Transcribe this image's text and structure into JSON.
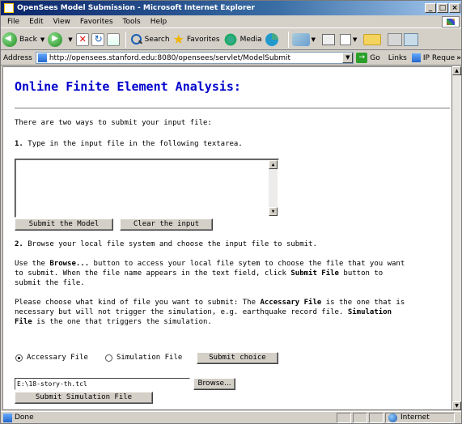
{
  "window": {
    "title": "OpenSees Model Submission - Microsoft Internet Explorer",
    "controls": [
      "_",
      "□",
      "×"
    ]
  },
  "menubar": {
    "items": [
      "File",
      "Edit",
      "View",
      "Favorites",
      "Tools",
      "Help"
    ]
  },
  "toolbar": {
    "back_label": "Back",
    "search_label": "Search",
    "favorites_label": "Favorites",
    "media_label": "Media"
  },
  "addressbar": {
    "label": "Address",
    "url": "http://opensees.stanford.edu:8080/opensees/servlet/ModelSubmit",
    "go_label": "Go",
    "links_label": "Links",
    "link_item": "IP Reque",
    "more": "»"
  },
  "page": {
    "title": "Online Finite Element Analysis:",
    "intro": "There are two ways to submit your input file:",
    "step1_num": "1.",
    "step1_text": " Type in the input file in the following textarea.",
    "textarea_value": "",
    "submit_model_label": "Submit the Model",
    "clear_input_label": "Clear the input",
    "step2_num": "2.",
    "step2_text": " Browse your local file system and choose the input file to submit.",
    "browse_p_1a": "Use the ",
    "browse_p_1b": "Browse...",
    "browse_p_1c": " button to access your local file sytem to choose the file that you want",
    "browse_p_2": "to submit. When the file name appears in the text field, click ",
    "browse_p_2b": "Submit File",
    "browse_p_2c": " button to",
    "browse_p_3": "submit the file.",
    "kind_p_1a": "Please choose what kind of file you want to submit: The ",
    "kind_p_1b": "Accessary File",
    "kind_p_1c": " is the one that is",
    "kind_p_2": "necessary but will not trigger the simulation, e.g. earthquake record file. ",
    "kind_p_2b": "Simulation",
    "kind_p_3a": "File",
    "kind_p_3b": " is the one that triggers the simulation.",
    "radio_accessary": "Accessary File",
    "radio_simulation": "Simulation File",
    "accessary_selected": true,
    "submit_choice_label": "Submit choice",
    "file_path": "E:\\18-story-th.tcl",
    "browse_button_label": "Browse...",
    "submit_simulation_label": "Submit Simulation File"
  },
  "statusbar": {
    "status": "Done",
    "zone": "Internet"
  }
}
